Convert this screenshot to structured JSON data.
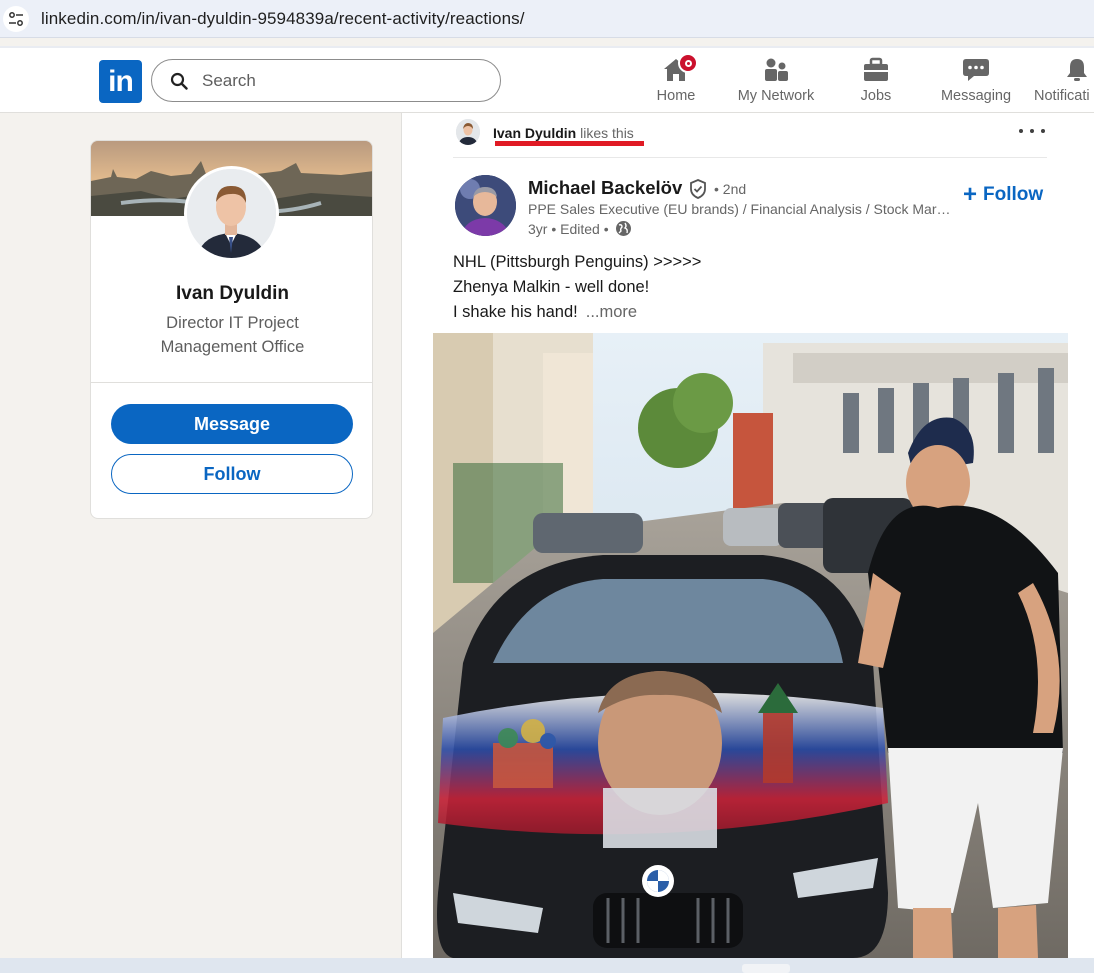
{
  "browser": {
    "url": "linkedin.com/in/ivan-dyuldin-9594839a/recent-activity/reactions/"
  },
  "nav": {
    "logo": "in",
    "search_placeholder": "Search",
    "items": [
      {
        "label": "Home",
        "icon": "home-icon"
      },
      {
        "label": "My Network",
        "icon": "network-icon"
      },
      {
        "label": "Jobs",
        "icon": "briefcase-icon"
      },
      {
        "label": "Messaging",
        "icon": "messaging-icon"
      },
      {
        "label": "Notificati",
        "icon": "bell-icon"
      }
    ]
  },
  "profile": {
    "name": "Ivan Dyuldin",
    "title": "Director IT Project Management Office",
    "message_label": "Message",
    "follow_label": "Follow"
  },
  "post": {
    "activity_name": "Ivan Dyuldin",
    "activity_action": "likes this",
    "author": "Michael Backelöv",
    "degree": "• 2nd",
    "headline": "PPE Sales Executive (EU brands) / Financial Analysis / Stock Market Expert",
    "meta": "3yr • Edited •",
    "follow_label": "Follow",
    "text_lines": [
      "NHL (Pittsburgh Penguins) >>>>>",
      "Zhenya Malkin - well done!",
      "I shake his hand!"
    ],
    "more_label": "...more"
  },
  "colors": {
    "brand": "#0a66c2",
    "notification_badge": "#cb112d",
    "highlight_underline": "#e01a24"
  }
}
